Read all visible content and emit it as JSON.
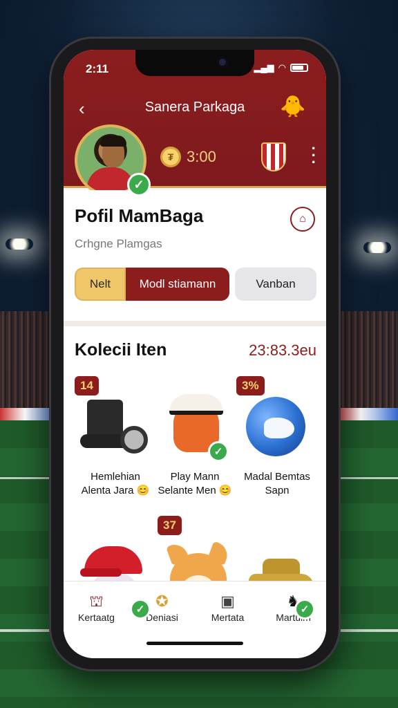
{
  "status_bar": {
    "time": "2:11"
  },
  "header": {
    "title": "Sanera Parkaga",
    "coins": "3:00"
  },
  "profile": {
    "name": "Pofil MamBaga",
    "subtitle": "Crhgne Plamgas",
    "segments": [
      "Nelt",
      "Modl stiamann",
      "Vanban"
    ]
  },
  "collection": {
    "title": "Kolecii Iten",
    "total": "23:83.3eu",
    "items": [
      {
        "tag": "14",
        "label_line1": "Hemlehian",
        "label_line2": "Alenta Jara",
        "emoji": "😊",
        "verified": false,
        "art": "boot-icon"
      },
      {
        "tag": "",
        "label_line1": "Play Mann",
        "label_line2": "Selante Men",
        "emoji": "😊",
        "verified": true,
        "art": "dragon-mascot-icon"
      },
      {
        "tag": "3%",
        "label_line1": "Madal Bemtas",
        "label_line2": "Sapn",
        "emoji": "",
        "verified": false,
        "art": "globe-icon"
      },
      {
        "tag": "",
        "verified": true,
        "art": "cap-creature-icon"
      },
      {
        "tag": "37",
        "verified": false,
        "art": "fox-icon"
      },
      {
        "tag": "",
        "verified": true,
        "art": "car-icon"
      }
    ]
  },
  "nav": [
    {
      "label": "Kertaatg",
      "icon": "shirt-icon"
    },
    {
      "label": "Deniasi",
      "icon": "trophy-icon"
    },
    {
      "label": "Mertata",
      "icon": "card-icon"
    },
    {
      "label": "Martuim",
      "icon": "dog-icon"
    }
  ],
  "colors": {
    "primary": "#8b1d1d",
    "accent_gold": "#e0b35a",
    "verified_green": "#3aaa4a",
    "segment_active": "#8b1d1d",
    "segment_gold": "#f0c66a"
  }
}
